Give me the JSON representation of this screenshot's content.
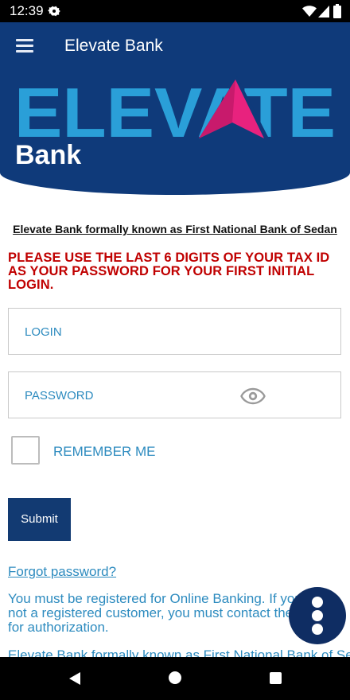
{
  "status_bar": {
    "time": "12:39"
  },
  "app_bar": {
    "title": "Elevate Bank",
    "menu_icon": "hamburger-menu-icon"
  },
  "logo": {
    "word1": "ELEVATE",
    "word2": "Bank",
    "accent_color": "#e8227e",
    "brand_color": "#2a9fd8"
  },
  "tagline": "Elevate Bank formally known as First National Bank of Sedan",
  "warning": "PLEASE USE THE LAST 6 DIGITS OF YOUR TAX ID AS YOUR PASSWORD FOR YOUR FIRST INITIAL LOGIN.",
  "form": {
    "login_label": "LOGIN",
    "password_label": "PASSWORD",
    "remember_label": "REMEMBER ME",
    "submit_label": "Submit"
  },
  "links": {
    "forgot": "Forgot password?"
  },
  "info": {
    "register": "You must be registered for Online Banking. If you are not a registered customer, you must contact the bank for authorization.",
    "footer": "Elevate Bank formally known as First National Bank of Sedan"
  },
  "colors": {
    "app_bar": "#0f3a7a",
    "warning": "#c00000",
    "link": "#2d8bbf",
    "submit": "#123a72",
    "fab": "#0f2d63"
  }
}
